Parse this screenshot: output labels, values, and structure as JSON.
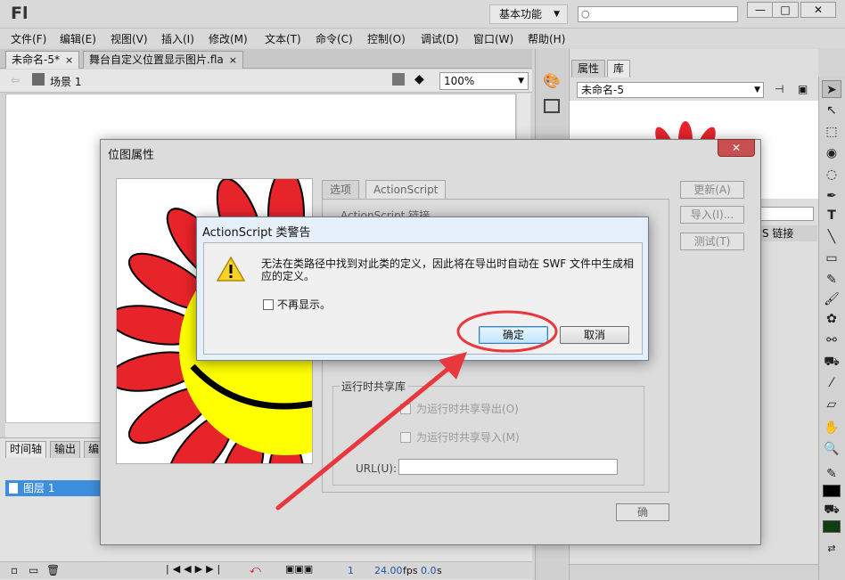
{
  "app": {
    "logo": "Fl",
    "workspace": "基本功能",
    "window_min": "—",
    "window_max": "□",
    "window_close": "✕"
  },
  "menu": [
    "文件(F)",
    "编辑(E)",
    "视图(V)",
    "插入(I)",
    "修改(M)",
    "文本(T)",
    "命令(C)",
    "控制(O)",
    "调试(D)",
    "窗口(W)",
    "帮助(H)"
  ],
  "doc_tabs": [
    {
      "label": "未命名-5*",
      "close": "×"
    },
    {
      "label": "舞台自定义位置显示图片.fla",
      "close": "×"
    }
  ],
  "scene": {
    "label": "场景 1",
    "zoom": "100%"
  },
  "timeline": {
    "tabs": [
      "时间轴",
      "输出",
      "编"
    ],
    "layer": "图层 1",
    "frame": "1",
    "fps": "24.00",
    "fps_unit": "fps",
    "time": "0.0",
    "time_unit": "s"
  },
  "props_panel": {
    "tabs": [
      "属性",
      "库"
    ],
    "library_doc": "未命名-5",
    "linkage_header": "S 链接"
  },
  "bitmap_dialog": {
    "title": "位图属性",
    "close": "✕",
    "tabs": [
      "选项",
      "ActionScript"
    ],
    "as_linkage_label": "ActionScript 链接",
    "rsl_group_label": "运行时共享库",
    "rsl_export": "为运行时共享导出(O)",
    "rsl_import": "为运行时共享导入(M)",
    "url_label": "URL(U):",
    "side_buttons": [
      "更新(A)",
      "导入(I)...",
      "测试(T)"
    ],
    "ok_partial": "确"
  },
  "warning_dialog": {
    "title": "ActionScript 类警告",
    "message": "无法在类路径中找到对此类的定义，因此将在导出时自动在 SWF 文件中生成相应的定义。",
    "dont_show_again": "不再显示。",
    "ok": "确定",
    "cancel": "取消"
  },
  "colors": {
    "annotation_red": "#e8383d",
    "ok_button_border": "#3c7fb1",
    "layer_highlight": "#3d8edc",
    "flower_petal": "#e8242b",
    "flower_center": "#ffff00"
  }
}
